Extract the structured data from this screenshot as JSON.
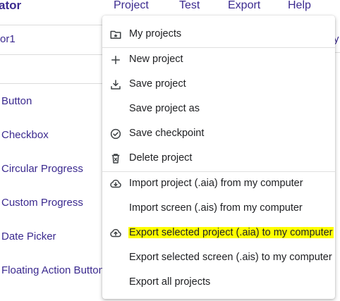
{
  "app": {
    "title_fragment": "ator",
    "screen_name_fragment": "or1",
    "right_fragment": "y"
  },
  "top_menu": {
    "project": "Project",
    "test": "Test",
    "export": "Export",
    "help": "Help"
  },
  "palette": {
    "items": [
      "Button",
      "Checkbox",
      "Circular Progress",
      "Custom Progress",
      "Date Picker",
      "Floating Action Button"
    ],
    "trailing": "."
  },
  "project_menu": {
    "items": [
      {
        "label": "My projects",
        "icon": "folder-star-icon"
      },
      {
        "label": "New project",
        "icon": "plus-icon"
      },
      {
        "label": "Save project",
        "icon": "download-tray-icon"
      },
      {
        "label": "Save project as",
        "icon": ""
      },
      {
        "label": "Save checkpoint",
        "icon": "check-circle-icon"
      },
      {
        "label": "Delete project",
        "icon": "trash-icon"
      },
      {
        "label": "Import project (.aia) from my computer",
        "icon": "cloud-download-icon"
      },
      {
        "label": "Import screen (.ais) from my computer",
        "icon": ""
      },
      {
        "label": "Export selected project (.aia) to my computer",
        "icon": "cloud-upload-icon",
        "highlighted": true
      },
      {
        "label": "Export selected screen (.ais) to my computer",
        "icon": ""
      },
      {
        "label": "Export all projects",
        "icon": ""
      }
    ]
  },
  "colors": {
    "brand_text": "#3b2a8f",
    "highlight": "#ffff00",
    "menu_text": "#202124"
  }
}
